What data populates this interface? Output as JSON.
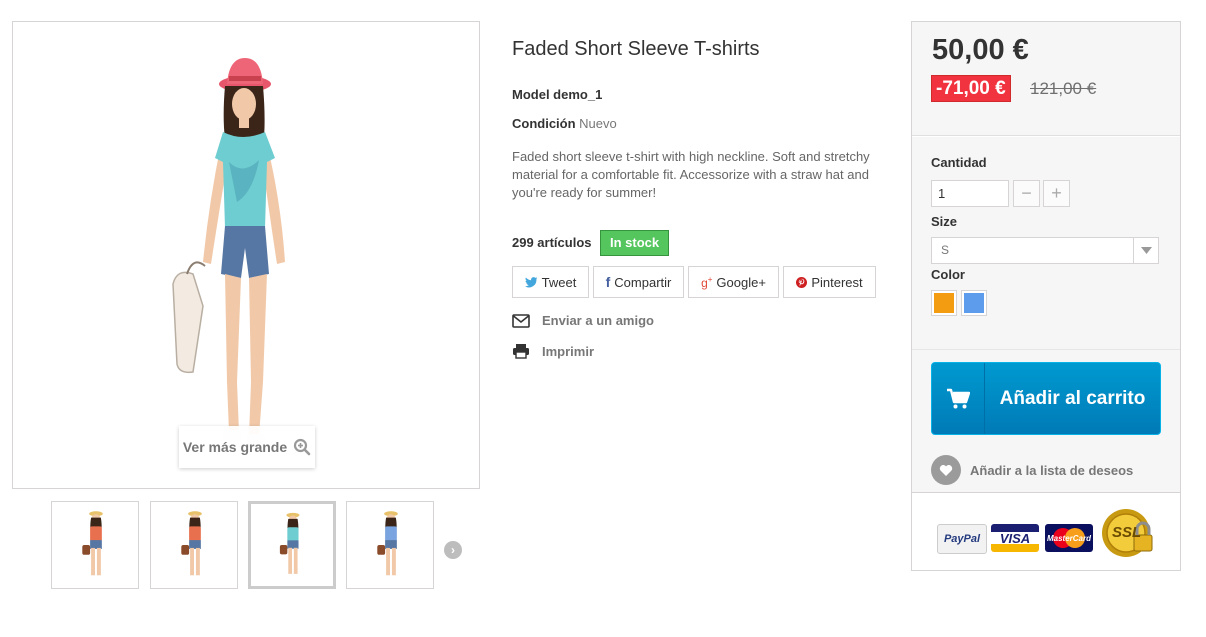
{
  "product": {
    "title": "Faded Short Sleeve T-shirts",
    "model": "Model demo_1",
    "condition_label": "Condición",
    "condition_value": "Nuevo",
    "description": "Faded short sleeve t-shirt with high neckline. Soft and stretchy material for a comfortable fit. Accessorize with a straw hat and you're ready for summer!",
    "quantity_text": "299 artículos",
    "stock_badge": "In stock"
  },
  "gallery": {
    "zoom_label": "Ver más grande",
    "thumbnails": [
      {
        "shirt_color": "#e8704e"
      },
      {
        "shirt_color": "#e8704e"
      },
      {
        "shirt_color": "#6ecdd0"
      },
      {
        "shirt_color": "#7aa4df"
      }
    ],
    "active_thumbnail": 2
  },
  "share": {
    "tweet": "Tweet",
    "facebook": "Compartir",
    "google": "Google+",
    "pinterest": "Pinterest"
  },
  "actions": {
    "send_friend": "Enviar a un amigo",
    "print": "Imprimir"
  },
  "pricing": {
    "price": "50,00 €",
    "reduction": "-71,00 €",
    "old_price": "121,00 €"
  },
  "options": {
    "quantity_label": "Cantidad",
    "quantity_value": "1",
    "size_label": "Size",
    "size_value": "S",
    "color_label": "Color",
    "colors": [
      "#f39c11",
      "#5d9cec"
    ]
  },
  "cart": {
    "add_to_cart": "Añadir al carrito",
    "wishlist": "Añadir a la lista de deseos"
  },
  "payment_logos": [
    "PayPal",
    "VISA",
    "MasterCard",
    "SSL"
  ],
  "colors": {
    "accent_blue": "#009ad0",
    "stock_green": "#55c65e",
    "reduction_red": "#f13340"
  }
}
